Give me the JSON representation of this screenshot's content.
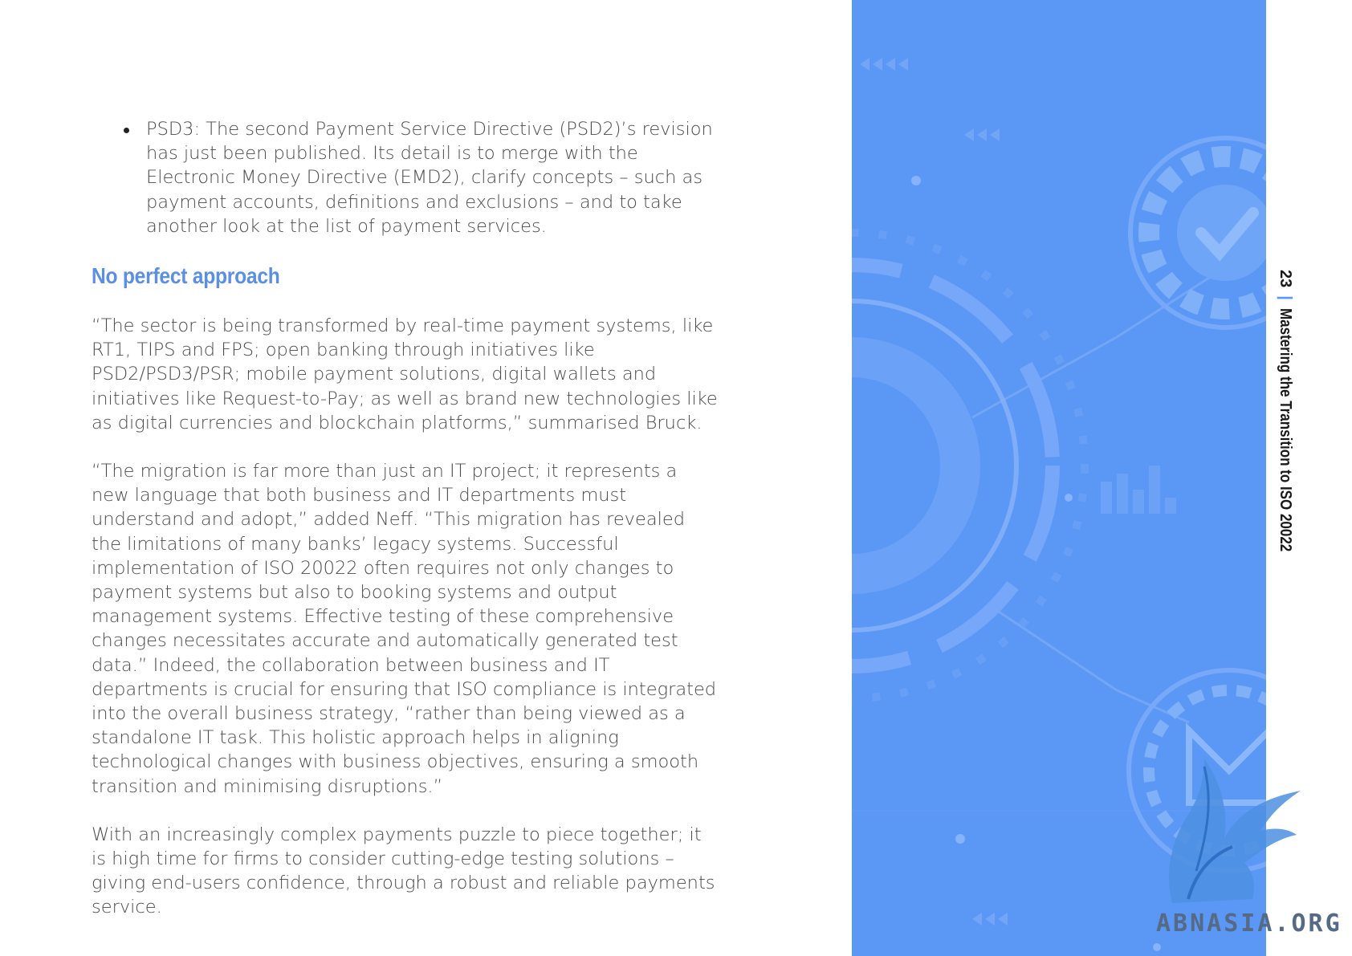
{
  "bullets": [
    "PSD3: The second Payment Service Directive (PSD2)’s revision has just been published. Its detail is to merge with the Electronic Money Directive (EMD2), clarify concepts – such as payment accounts, definitions and exclusions – and to take another look at the list of payment services."
  ],
  "section_heading": "No perfect approach",
  "paragraphs": [
    "“The sector is being transformed by real-time payment systems, like RT1, TIPS and FPS; open banking through initiatives like PSD2/PSD3/PSR; mobile payment solutions, digital wallets and initiatives like Request-to-Pay; as well as brand new technologies like as digital currencies and blockchain platforms,” summarised Bruck.",
    "“The migration is far more than just an IT project; it represents a new language that both business and IT departments must understand and adopt,” added Neff. “This migration has revealed the limitations of many banks’ legacy systems. Successful implementation of ISO 20022 often requires not only changes to payment systems but also to booking systems and output management systems. Effective testing of these comprehensive changes necessitates accurate and automatically generated test data.” Indeed, the collaboration between business and IT departments is crucial for ensuring that ISO compliance is integrated into the overall business strategy, “rather than being viewed as a standalone IT task. This holistic approach helps in aligning technological changes with business objectives, ensuring a smooth transition and minimising disruptions.”",
    "With an increasingly complex payments puzzle to piece together; it is high time for firms to consider cutting-edge testing solutions – giving end-users confidence, through a robust and reliable payments service."
  ],
  "side_label": {
    "page_number": "23",
    "separator": "|",
    "title": "Mastering the Transition to ISO 20022"
  },
  "watermark": "ABNASIA.ORG",
  "colors": {
    "heading": "#5a8fe3",
    "panel": "#5b97f5",
    "body_text": "#4b4b4b"
  },
  "icons": [
    "gear-decoration-icon",
    "checkmark-gear-icon",
    "shield-icon",
    "griffin-logo-icon"
  ]
}
